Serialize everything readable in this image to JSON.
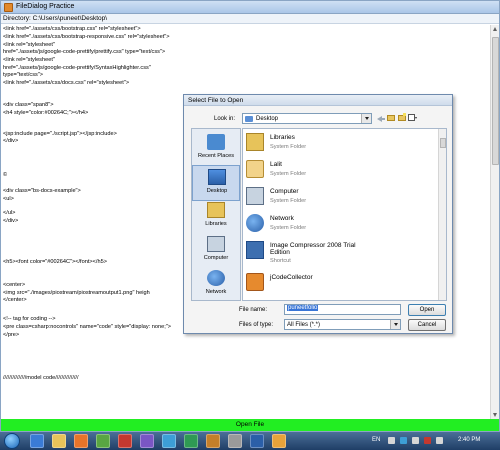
{
  "window": {
    "title": "FileDialog Practice",
    "directory": "Directory: C:\\Users\\puneet\\Desktop\\"
  },
  "code_lines": [
    "<link href=\"./assets/css/bootstrap.css\" rel=\"stylesheet\">",
    "<link href=\"./assets/css/bootstrap-responsive.css\" rel=\"stylesheet\">",
    "<link rel=\"stylesheet\"",
    "        href=\"./assets/js/google-code-prettify/prettify.css\" type=\"text/css\">",
    "<link rel=\"stylesheet\"",
    "        href=\"./assets/js/google-code-prettify/SyntaxHighlighter.css\"",
    "        type=\"text/css\">",
    "<link href=\"./assets/css/docs.css\" rel=\"stylesheet\">",
    "<div class=\"span8\">",
    "<h4 style=\"color:#00264C;\"></h4>",
    "<jsp:include page=\"./script.jsp\"></jsp:include>",
    "</div>",
    "©",
    "<div class=\"bs-docs-example\">",
    "<ul>",
    "</ul>",
    "</div>",
    "<h5><font color=\"#00264C\"></font></h5>",
    "<center>",
    "        <img src=\"./images/piostream/piostreamoutput1.png\" heigh",
    "</center>",
    "<!-- tag for coding  -->",
    "                    <pre class=csharp:nocontrols\" name=\"code\" style=\"display: none;\">",
    "</pre>",
    "///////////////model code///////////////"
  ],
  "open_bar": "Open File",
  "dialog": {
    "title": "Select File to Open",
    "look_in_label": "Look in:",
    "look_in_value": "Desktop",
    "places": [
      {
        "label": "Recent Places",
        "icon": "recent-places-icon"
      },
      {
        "label": "Desktop",
        "icon": "desktop-icon"
      },
      {
        "label": "Libraries",
        "icon": "libraries-icon"
      },
      {
        "label": "Computer",
        "icon": "computer-icon"
      },
      {
        "label": "Network",
        "icon": "network-icon"
      }
    ],
    "files": [
      {
        "name": "Libraries",
        "sub": "System Folder",
        "icon": "libraries-icon"
      },
      {
        "name": "Lalit",
        "sub": "System Folder",
        "icon": "user-folder-icon"
      },
      {
        "name": "Computer",
        "sub": "System Folder",
        "icon": "computer-icon"
      },
      {
        "name": "Network",
        "sub": "System Folder",
        "icon": "network-icon"
      },
      {
        "name": "Image Compressor 2008 Trial",
        "name2": "Edition",
        "sub": "Shortcut",
        "icon": "image-compressor-icon"
      },
      {
        "name": "jCodeCollector",
        "icon": "jcodecollector-icon"
      }
    ],
    "file_name_label": "File name:",
    "file_name_value": "puneetfolio",
    "files_of_type_label": "Files of type:",
    "files_of_type_value": "All Files (*.*)",
    "open_button": "Open",
    "cancel_button": "Cancel"
  },
  "taskbar": {
    "lang": "EN",
    "time": "2:40 PM"
  }
}
